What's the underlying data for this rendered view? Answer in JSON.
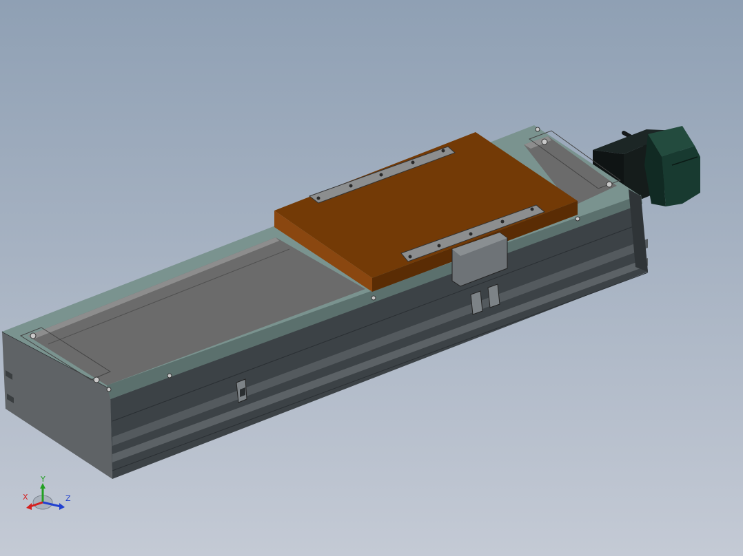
{
  "viewport": {
    "background_top": "#8fa0b4",
    "background_bottom": "#c4cad5"
  },
  "model": {
    "components": [
      "linear-module-base",
      "carriage-plate",
      "servo-motor",
      "motor-shaft",
      "limit-sensor-left",
      "limit-sensor-right"
    ],
    "colors": {
      "carriage": "#7a3a05",
      "frame_dark": "#3d4448",
      "frame_mid": "#5a5f62",
      "cover_teal": "#6f8c89",
      "cover_gray": "#6d6d6d",
      "motor": "#1f2a27",
      "motor_green": "#1a3f33"
    }
  },
  "triad": {
    "x_label": "X",
    "y_label": "Y",
    "z_label": "Z",
    "x_color": "#d42020",
    "y_color": "#22a022",
    "z_color": "#2040d0"
  }
}
